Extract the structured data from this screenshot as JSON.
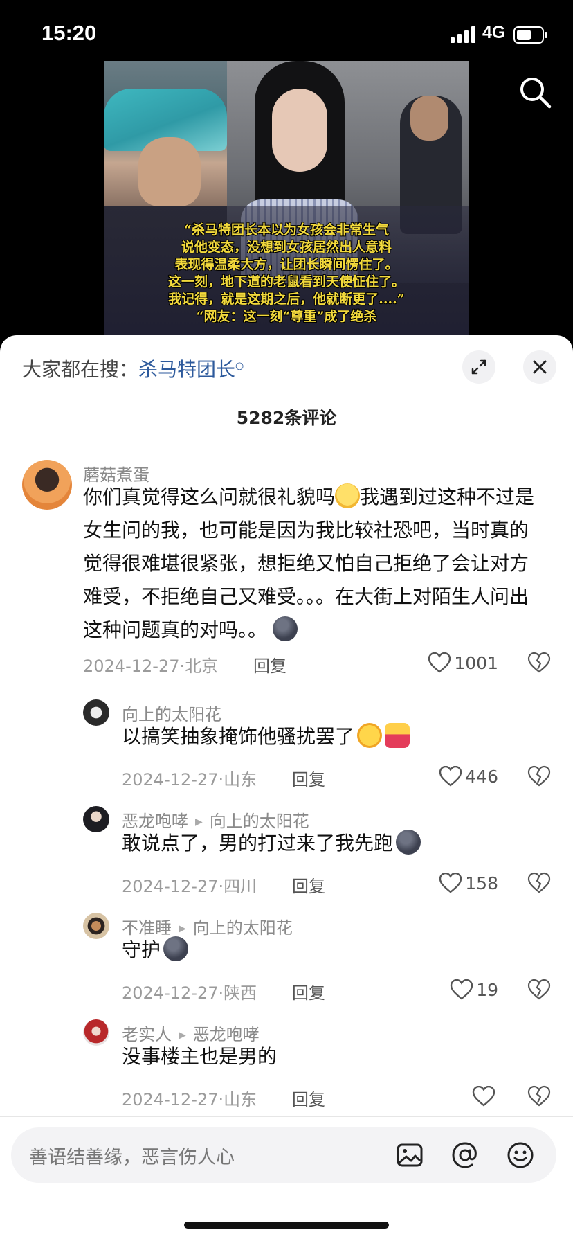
{
  "status_bar": {
    "time": "15:20",
    "network": "4G"
  },
  "video": {
    "caption_lines": "“杀马特团长本以为女孩会非常生气\n说他变态，没想到女孩居然出人意料\n表现得温柔大方，让团长瞬间愣住了。\n这一刻，地下道的老鼠看到天使怔住了。\n我记得，就是这期之后，他就断更了....”\n“网友：这一刻“尊重”成了绝杀"
  },
  "sheet": {
    "trending_prefix": "大家都在搜：",
    "trending_keyword": "杀马特团长",
    "comment_count": "5282条评论"
  },
  "comments": [
    {
      "author": "蘑菇煮蛋",
      "text_a": "你们真觉得这么问就很礼貌吗",
      "text_b": "我遇到过这种不过是女生问的我，也可能是因为我比较社恐吧，当时真的觉得很难堪很紧张，想拒绝又怕自己拒绝了会让对方难受，不拒绝自己又难受。。。在大街上对陌生人问出这种问题真的对吗。。",
      "date_loc": "2024-12-27·北京",
      "reply": "回复",
      "likes": "1001"
    },
    {
      "author": "向上的太阳花",
      "text": "以搞笑抽象掩饰他骚扰罢了",
      "date_loc": "2024-12-27·山东",
      "reply": "回复",
      "likes": "446"
    },
    {
      "author": "恶龙咆哮",
      "reply_to": "向上的太阳花",
      "text": "敢说点了，男的打过来了我先跑",
      "date_loc": "2024-12-27·四川",
      "reply": "回复",
      "likes": "158"
    },
    {
      "author": "不准睡",
      "reply_to": "向上的太阳花",
      "text": "守护",
      "date_loc": "2024-12-27·陕西",
      "reply": "回复",
      "likes": "19"
    },
    {
      "author": "老实人",
      "reply_to": "恶龙咆哮",
      "text": "没事楼主也是男的",
      "date_loc": "2024-12-27·山东",
      "reply": "回复",
      "likes": ""
    }
  ],
  "input": {
    "placeholder": "善语结善缘，恶言伤人心"
  },
  "icons": {
    "search": "search-icon",
    "expand": "expand-icon",
    "close": "close-icon",
    "like": "heart-icon",
    "dislike": "broken-heart-icon",
    "image": "image-icon",
    "mention": "at-icon",
    "emoji": "emoji-icon"
  }
}
